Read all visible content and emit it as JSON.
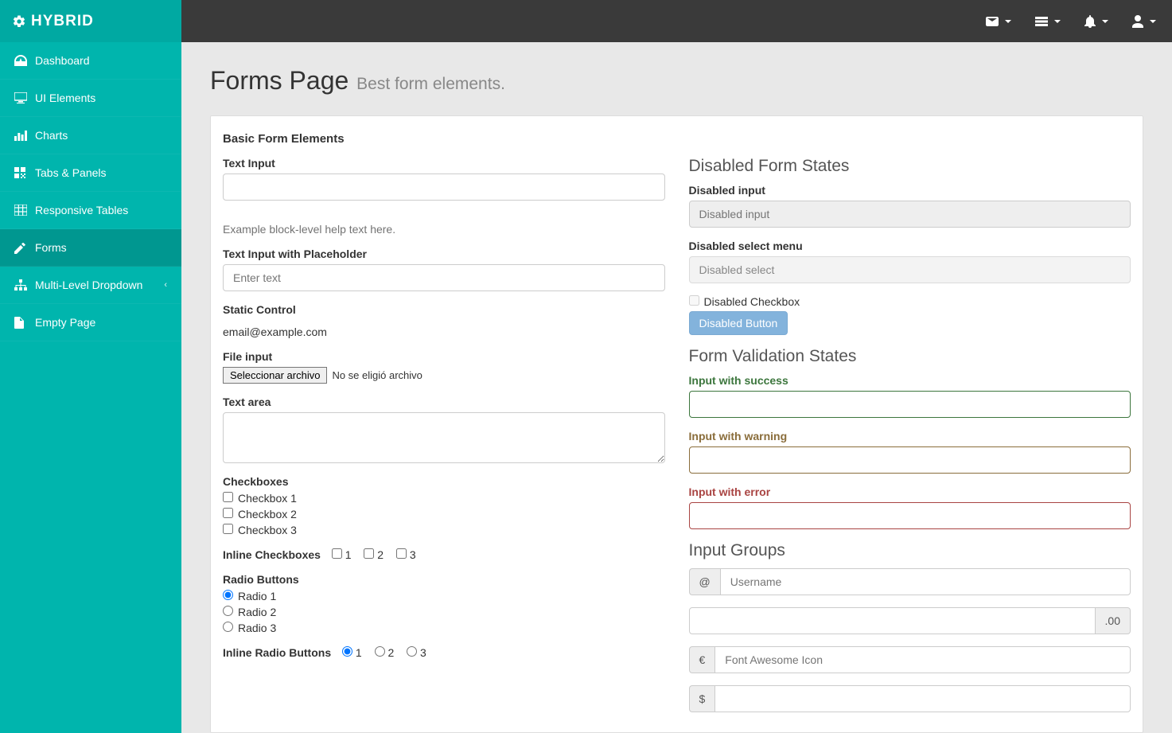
{
  "brand": "HYBRID",
  "sidebar": {
    "items": [
      {
        "label": "Dashboard"
      },
      {
        "label": "UI Elements"
      },
      {
        "label": "Charts"
      },
      {
        "label": "Tabs & Panels"
      },
      {
        "label": "Responsive Tables"
      },
      {
        "label": "Forms"
      },
      {
        "label": "Multi-Level Dropdown"
      },
      {
        "label": "Empty Page"
      }
    ]
  },
  "header": {
    "title": "Forms Page",
    "subtitle": "Best form elements."
  },
  "panel": {
    "title": "Basic Form Elements"
  },
  "left": {
    "text_input_label": "Text Input",
    "help_text": "Example block-level help text here.",
    "placeholder_label": "Text Input with Placeholder",
    "placeholder_text": "Enter text",
    "static_label": "Static Control",
    "static_value": "email@example.com",
    "file_label": "File input",
    "file_button": "Seleccionar archivo",
    "file_status": "No se eligió archivo",
    "textarea_label": "Text area",
    "checkboxes_label": "Checkboxes",
    "cb1": "Checkbox 1",
    "cb2": "Checkbox 2",
    "cb3": "Checkbox 3",
    "inline_cb_label": "Inline Checkboxes",
    "icb1": "1",
    "icb2": "2",
    "icb3": "3",
    "radios_label": "Radio Buttons",
    "r1": "Radio 1",
    "r2": "Radio 2",
    "r3": "Radio 3",
    "inline_radio_label": "Inline Radio Buttons",
    "ir1": "1",
    "ir2": "2",
    "ir3": "3"
  },
  "right": {
    "disabled_title": "Disabled Form States",
    "disabled_input_label": "Disabled input",
    "disabled_input_placeholder": "Disabled input",
    "disabled_select_label": "Disabled select menu",
    "disabled_select_option": "Disabled select",
    "disabled_checkbox": "Disabled Checkbox",
    "disabled_button": "Disabled Button",
    "validation_title": "Form Validation States",
    "success_label": "Input with success",
    "warning_label": "Input with warning",
    "error_label": "Input with error",
    "groups_title": "Input Groups",
    "at": "@",
    "username_placeholder": "Username",
    "suffix_zero": ".00",
    "euro": "€",
    "fa_placeholder": "Font Awesome Icon",
    "dollar": "$"
  }
}
